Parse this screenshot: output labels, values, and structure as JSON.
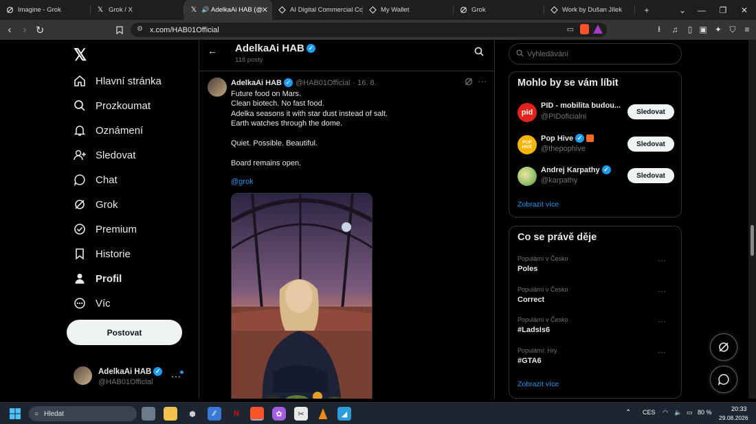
{
  "browser": {
    "tabs": [
      {
        "title": "Imagine - Grok",
        "icon": "grok-icon",
        "active": false
      },
      {
        "title": "Grok / X",
        "icon": "x-logo-icon",
        "active": false
      },
      {
        "title": "AdelkaAi HAB (@",
        "icon": "x-logo-icon",
        "active": true
      },
      {
        "title": "AI Digital Commercial Co",
        "icon": "notion-icon",
        "active": false
      },
      {
        "title": "My Wallet",
        "icon": "wallet-icon",
        "active": false
      },
      {
        "title": "Grok",
        "icon": "grok-icon",
        "active": false
      },
      {
        "title": "Work by Dušan Jílek",
        "icon": "site-icon",
        "active": false
      }
    ],
    "url": "x.com/HAB01Official"
  },
  "nav": {
    "items": [
      {
        "label": "Hlavní stránka",
        "icon": "home-icon"
      },
      {
        "label": "Prozkoumat",
        "icon": "search-icon"
      },
      {
        "label": "Oznámení",
        "icon": "bell-icon"
      },
      {
        "label": "Sledovat",
        "icon": "follow-user-icon"
      },
      {
        "label": "Chat",
        "icon": "chat-icon"
      },
      {
        "label": "Grok",
        "icon": "grok-icon"
      },
      {
        "label": "Premium",
        "icon": "verified-badge-icon"
      },
      {
        "label": "Historie",
        "icon": "bookmark-icon"
      },
      {
        "label": "Profil",
        "icon": "profile-icon"
      },
      {
        "label": "Víc",
        "icon": "more-circle-icon"
      }
    ],
    "post_button": "Postovat",
    "account": {
      "name": "AdelkaAi HAB",
      "handle": "@HAB01Official"
    }
  },
  "profile_header": {
    "name": "AdelkaAi HAB",
    "post_count": "118 posty"
  },
  "tweet": {
    "author": "AdelkaAi HAB",
    "handle": "@HAB01Official",
    "date": "· 16. 8.",
    "lines": [
      "Future food on Mars.",
      "Clean biotech. No fast food.",
      "Adelka seasons it with star dust instead of salt.",
      "Earth watches through the dome.",
      "",
      "Quiet. Possible. Beautiful.",
      "",
      "Board remains open."
    ],
    "mention": "@grok"
  },
  "right": {
    "search_placeholder": "Vyhledávání",
    "suggestions": {
      "title": "Mohlo by se vám líbit",
      "items": [
        {
          "name": "PID - mobilita budou...",
          "handle": "@PIDoficialni",
          "button": "Sledovat",
          "avatar_text": "pid",
          "avatar_color": "#e2231a"
        },
        {
          "name": "Pop Hive",
          "handle": "@thepophive",
          "button": "Sledovat",
          "avatar_text": "POP HIVE",
          "avatar_color": "#f4b400"
        },
        {
          "name": "Andrej Karpathy",
          "handle": "@karpathy",
          "button": "Sledovat",
          "avatar_text": "",
          "avatar_color": "#8fbf6a"
        }
      ],
      "show_more": "Zobrazit více"
    },
    "trends": {
      "title": "Co se právě děje",
      "items": [
        {
          "context": "Populární v Česko",
          "name": "Poles"
        },
        {
          "context": "Populární v Česko",
          "name": "Correct"
        },
        {
          "context": "Populární v Česko",
          "name": "#LadsIs6"
        },
        {
          "context": "Populární: Hry",
          "name": "#GTA6"
        }
      ],
      "show_more": "Zobrazit více"
    }
  },
  "taskbar": {
    "search_placeholder": "Hledat",
    "lang": "CES",
    "battery": "80 %",
    "time": "20:33",
    "date": "29.08.2026"
  },
  "colors": {
    "accent": "#1d9bf0",
    "background": "#000000",
    "border": "#2f3336"
  }
}
